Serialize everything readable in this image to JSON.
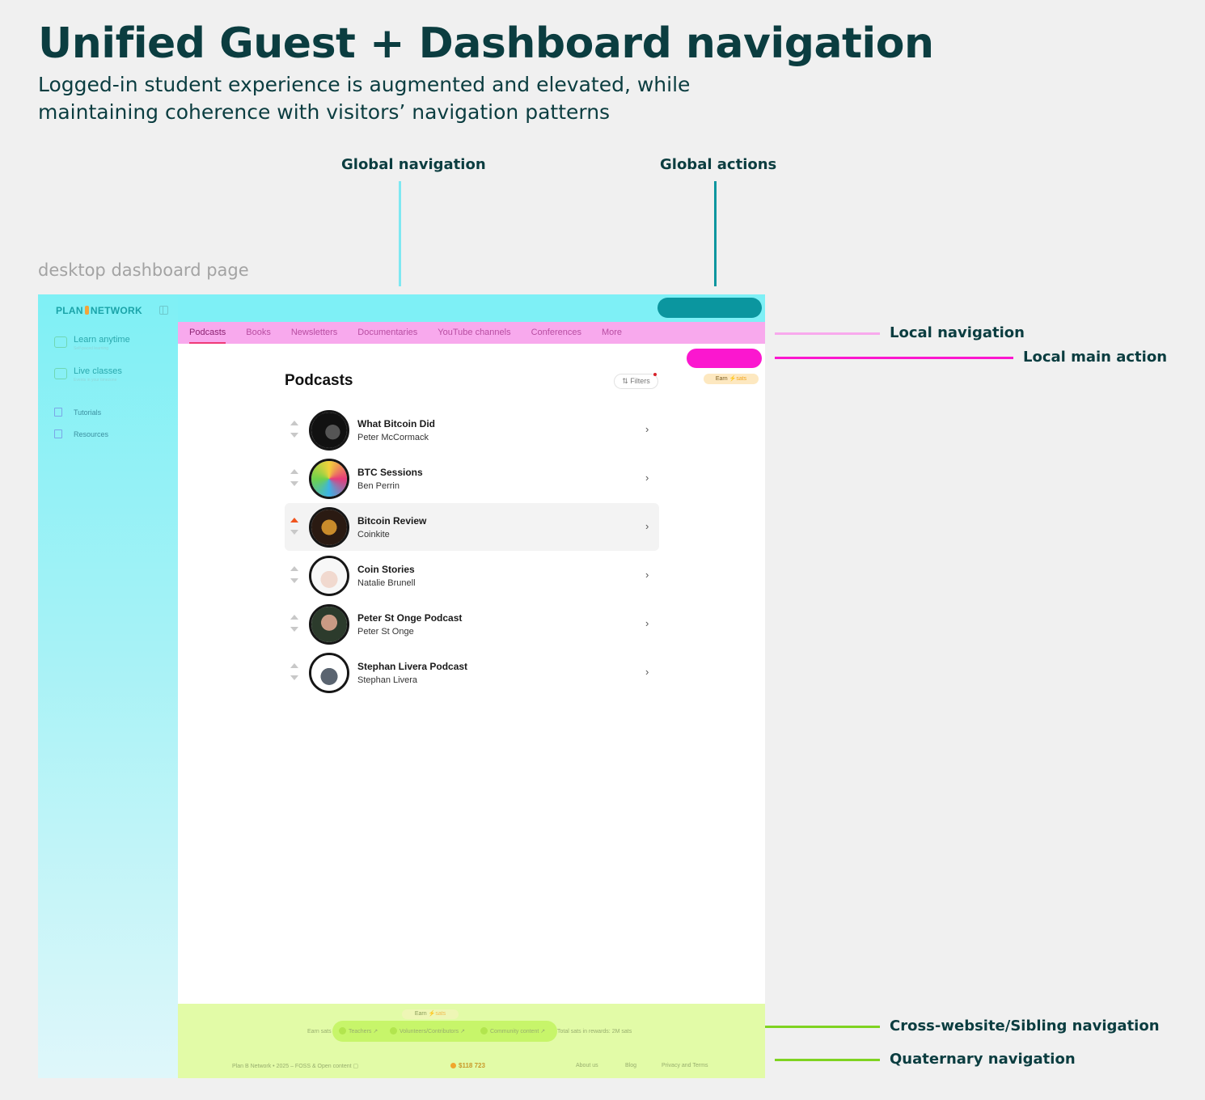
{
  "header": {
    "title": "Unified Guest + Dashboard navigation",
    "subtitle": "Logged-in student experience is augmented and elevated, while maintaining coherence with visitors’ navigation patterns",
    "caption": "desktop dashboard page"
  },
  "annotations": {
    "global_navigation": "Global navigation",
    "global_actions": "Global actions",
    "local_navigation": "Local navigation",
    "local_main_action": "Local main action",
    "cross_website": "Cross-website/Sibling navigation",
    "quaternary": "Quaternary navigation"
  },
  "colors": {
    "global": "#7ef0f6",
    "global_action": "#0b969f",
    "local": "#f8a9ed",
    "local_action": "#fb17cf",
    "cross": "#c7f56a",
    "quaternary": "#e2fba7"
  },
  "app": {
    "logo_left": "PLAN",
    "logo_right": "NETWORK",
    "sidebar": {
      "main_items": [
        {
          "label": "Learn anytime",
          "sub": "Self-paced learning",
          "icon": "book-icon"
        },
        {
          "label": "Live classes",
          "sub": "Events in your timezone",
          "icon": "calendar-icon"
        }
      ],
      "small_items": [
        {
          "label": "Tutorials",
          "icon": "tutorial-icon"
        },
        {
          "label": "Resources",
          "icon": "resources-icon"
        }
      ]
    },
    "tabs": [
      "Podcasts",
      "Books",
      "Newsletters",
      "Documentaries",
      "YouTube channels",
      "Conferences",
      "More"
    ],
    "active_tab": "Podcasts",
    "earn_label": "Earn",
    "earn_sats": "sats",
    "page_title": "Podcasts",
    "filters_label": "Filters",
    "podcasts": [
      {
        "name": "What Bitcoin Did",
        "author": "Peter McCormack",
        "upvoted": false,
        "highlighted": false
      },
      {
        "name": "BTC Sessions",
        "author": "Ben Perrin",
        "upvoted": false,
        "highlighted": false
      },
      {
        "name": "Bitcoin Review",
        "author": "Coinkite",
        "upvoted": true,
        "highlighted": true
      },
      {
        "name": "Coin Stories",
        "author": "Natalie Brunell",
        "upvoted": false,
        "highlighted": false
      },
      {
        "name": "Peter St Onge Podcast",
        "author": "Peter St Onge",
        "upvoted": false,
        "highlighted": false
      },
      {
        "name": "Stephan Livera Podcast",
        "author": "Stephan Livera",
        "upvoted": false,
        "highlighted": false
      }
    ],
    "footer": {
      "earn_sats_label": "Earn sats",
      "links": [
        "Teachers",
        "Volunteers/Contributors",
        "Community content"
      ],
      "total": "Total sats in rewards: 2M sats",
      "copyright": "Plan B Network • 2025 – FOSS & Open content",
      "sats_counter": "$118 723",
      "bottom_links": [
        "About us",
        "Blog",
        "Privacy and Terms"
      ]
    }
  }
}
